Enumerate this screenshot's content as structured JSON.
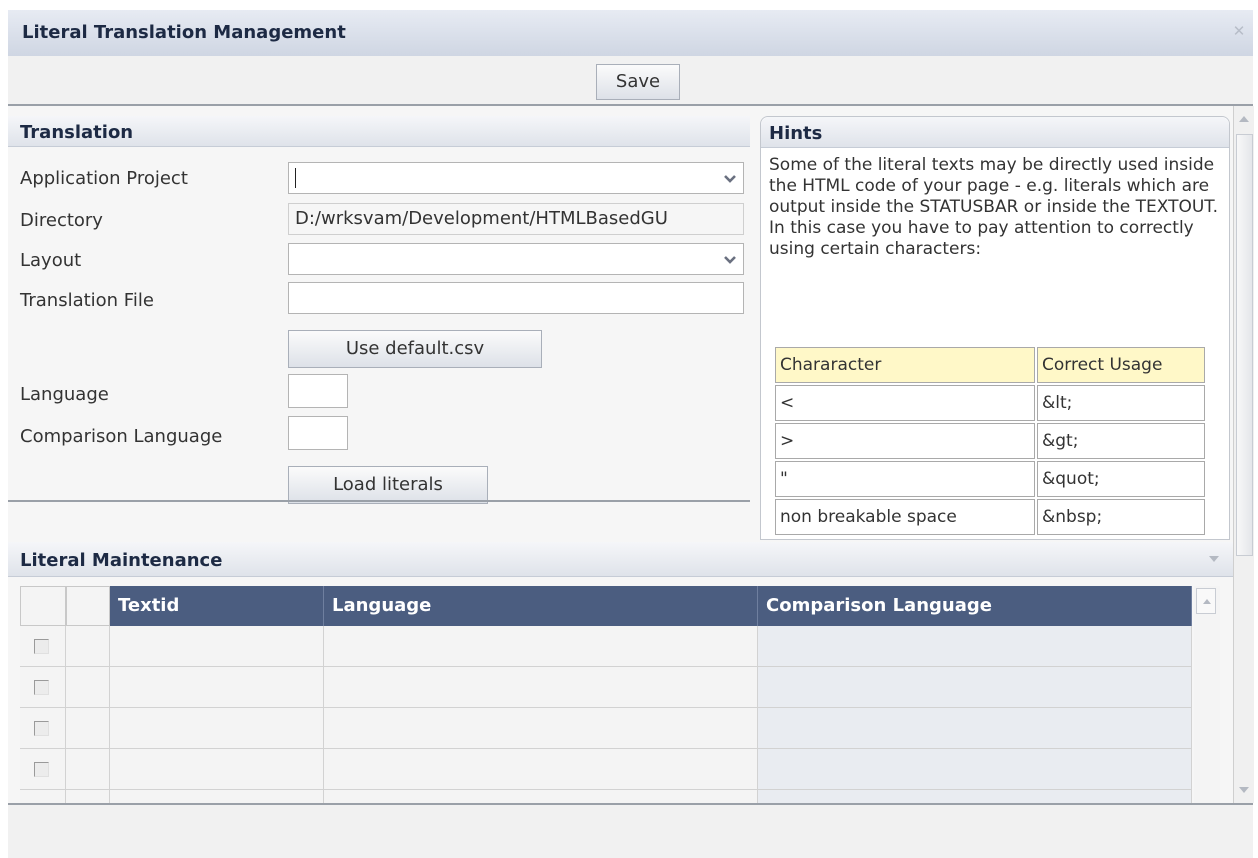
{
  "window": {
    "title": "Literal Translation Management"
  },
  "toolbar": {
    "save_label": "Save"
  },
  "translation": {
    "section_title": "Translation",
    "application_project": {
      "label": "Application Project",
      "value": ""
    },
    "directory": {
      "label": "Directory",
      "value": "D:/wrksvam/Development/HTMLBasedGU"
    },
    "layout": {
      "label": "Layout",
      "value": ""
    },
    "translation_file": {
      "label": "Translation File",
      "value": ""
    },
    "use_default_label": "Use default.csv",
    "language": {
      "label": "Language",
      "value": ""
    },
    "comparison_language": {
      "label": "Comparison Language",
      "value": ""
    },
    "load_literals_label": "Load literals"
  },
  "hints": {
    "title": "Hints",
    "text": "Some of the literal texts may be directly used inside the HTML code of your page - e.g. literals which are output inside the STATUSBAR or inside the TEXTOUT. In this case you have to pay attention to correctly using certain  characters:",
    "table": {
      "headers": [
        "Chararacter",
        "Correct Usage"
      ],
      "rows": [
        [
          "<",
          "&lt;"
        ],
        [
          ">",
          "&gt;"
        ],
        [
          "\"",
          "&quot;"
        ],
        [
          "non breakable space",
          "&nbsp;"
        ]
      ]
    }
  },
  "literal_maintenance": {
    "title": "Literal Maintenance",
    "columns": [
      "Textid",
      "Language",
      "Comparison Language"
    ],
    "rows": [
      {
        "textid": "",
        "language": "",
        "comparison": ""
      },
      {
        "textid": "",
        "language": "",
        "comparison": ""
      },
      {
        "textid": "",
        "language": "",
        "comparison": ""
      },
      {
        "textid": "",
        "language": "",
        "comparison": ""
      },
      {
        "textid": "",
        "language": "",
        "comparison": ""
      }
    ]
  },
  "colors": {
    "header_dark": "#4b5d80",
    "hint_header_yellow": "#fff8c8",
    "panel_bg": "#f6f6f6"
  },
  "icons": [
    "close-icon",
    "chevron-down-icon",
    "scroll-up-icon",
    "scroll-down-icon",
    "checkbox-icon"
  ]
}
